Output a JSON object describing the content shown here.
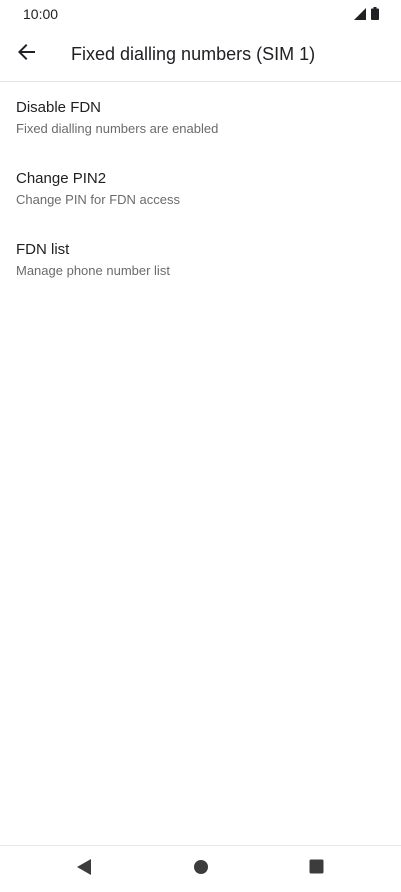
{
  "status_bar": {
    "time": "10:00",
    "icons": [
      "signal-icon",
      "battery-icon"
    ]
  },
  "app_bar": {
    "back_icon": "arrow-back-icon",
    "title": "Fixed dialling numbers (SIM 1)"
  },
  "preferences": [
    {
      "title": "Disable FDN",
      "summary": "Fixed dialling numbers are enabled"
    },
    {
      "title": "Change PIN2",
      "summary": "Change PIN for FDN access"
    },
    {
      "title": "FDN list",
      "summary": "Manage phone number list"
    }
  ],
  "nav_bar": {
    "icons": [
      "nav-back-icon",
      "nav-home-icon",
      "nav-recents-icon"
    ]
  },
  "colors": {
    "text_primary": "#202124",
    "text_secondary": "#6b6b6b",
    "divider": "#e3e3e3",
    "nav_icon": "#3c3c3c"
  }
}
